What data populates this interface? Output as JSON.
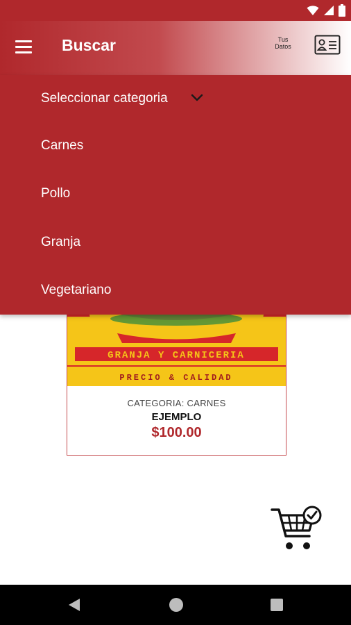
{
  "app_bar": {
    "title": "Buscar",
    "tus_datos_line1": "Tus",
    "tus_datos_line2": "Datos"
  },
  "dropdown": {
    "select_label": "Seleccionar categoria",
    "items": [
      {
        "label": "Carnes"
      },
      {
        "label": "Pollo"
      },
      {
        "label": "Granja"
      },
      {
        "label": "Vegetariano"
      }
    ]
  },
  "product": {
    "banner_line1": "GRANJA Y CARNICERIA",
    "banner_line2": "PRECIO & CALIDAD",
    "category": "CATEGORIA: CARNES",
    "name": "EJEMPLO",
    "price": "$100.00"
  },
  "colors": {
    "brand_red": "#b0282c",
    "banner_yellow": "#f5c518",
    "white": "#ffffff"
  },
  "icons": [
    "menu-icon",
    "id-card-icon",
    "chevron-down-icon",
    "cart-check-icon",
    "wifi-icon",
    "signal-icon",
    "battery-icon",
    "nav-back-icon",
    "nav-home-icon",
    "nav-recent-icon"
  ]
}
